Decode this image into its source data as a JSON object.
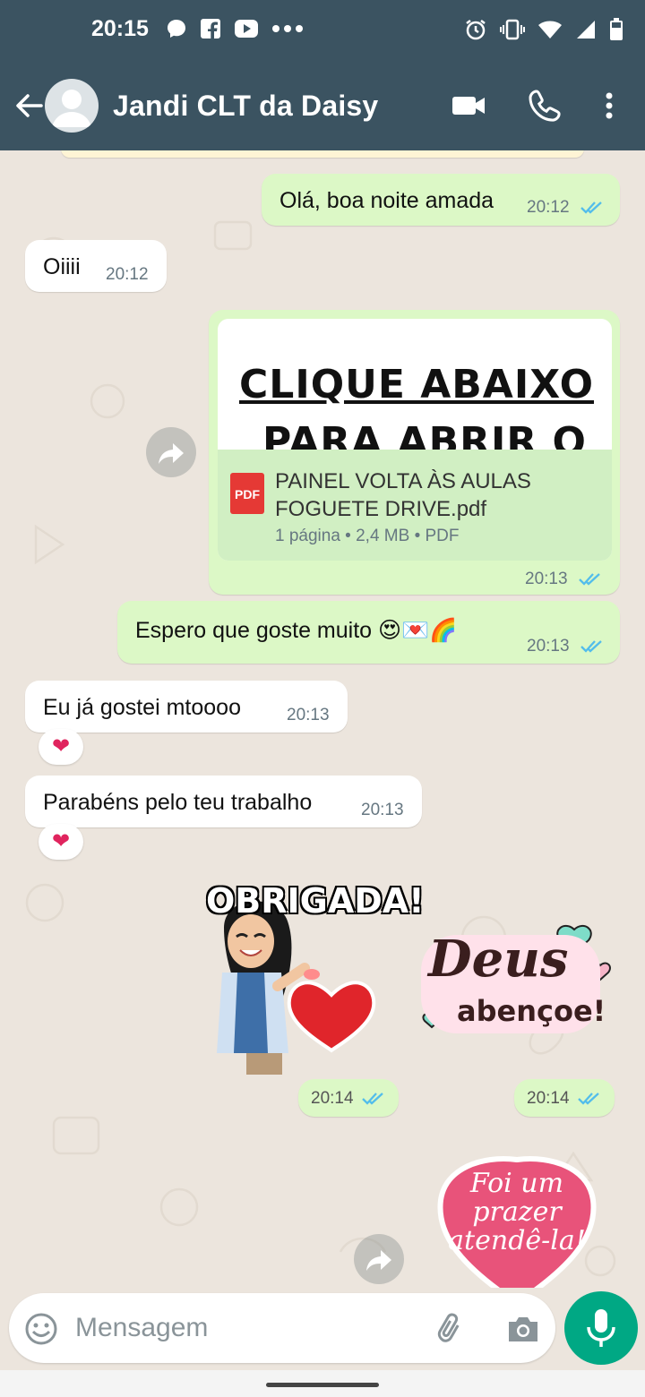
{
  "status_bar": {
    "time": "20:15",
    "left_icons": [
      "chat-bubble-icon",
      "facebook-icon",
      "youtube-icon",
      "more-dots-icon"
    ],
    "right_icons": [
      "alarm-icon",
      "vibrate-icon",
      "wifi-icon",
      "signal-icon",
      "battery-icon"
    ]
  },
  "header": {
    "contact_name": "Jandi CLT da Daisy",
    "icons": [
      "back-arrow-icon",
      "avatar",
      "video-call-icon",
      "phone-icon",
      "more-vert-icon"
    ]
  },
  "messages": [
    {
      "direction": "out",
      "text": "Olá, boa noite amada",
      "time": "20:12",
      "status": "read"
    },
    {
      "direction": "in",
      "text": "Oiiii",
      "time": "20:12"
    },
    {
      "direction": "out",
      "type": "document",
      "preview_line1": "CLIQUE ABAIXO",
      "preview_line2": "PARA ABRIR O",
      "file_type_label": "PDF",
      "file_name_line1": "PAINEL VOLTA ÀS AULAS",
      "file_name_line2": "FOGUETE DRIVE.pdf",
      "file_meta": "1 página • 2,4 MB • PDF",
      "time": "20:13",
      "status": "read"
    },
    {
      "direction": "out",
      "text": "Espero que goste muito 😍💌🌈",
      "time": "20:13",
      "status": "read"
    },
    {
      "direction": "in",
      "text": "Eu já gostei mtoooo",
      "time": "20:13",
      "reaction": "❤"
    },
    {
      "direction": "in",
      "text": "Parabéns pelo teu trabalho",
      "time": "20:13",
      "reaction": "❤"
    },
    {
      "direction": "out",
      "type": "sticker",
      "sticker_text": "OBRIGADA!",
      "time": "20:14",
      "status": "read"
    },
    {
      "direction": "out",
      "type": "sticker",
      "sticker_text_1": "Deus",
      "sticker_text_2": "abençoe!",
      "time": "20:14",
      "status": "read"
    },
    {
      "direction": "out",
      "type": "sticker",
      "sticker_text_1": "Foi um",
      "sticker_text_2": "prazer",
      "sticker_text_3": "atendê-la!"
    }
  ],
  "composer": {
    "placeholder": "Mensagem",
    "icons": [
      "emoji-icon",
      "attach-icon",
      "camera-icon",
      "mic-icon"
    ]
  },
  "colors": {
    "header": "#3B5361",
    "chat_background": "#ECE5DD",
    "outgoing_bubble": "#DCF8C6",
    "incoming_bubble": "#FFFFFF",
    "read_ticks": "#53BDEB",
    "mic_button": "#00A884"
  }
}
